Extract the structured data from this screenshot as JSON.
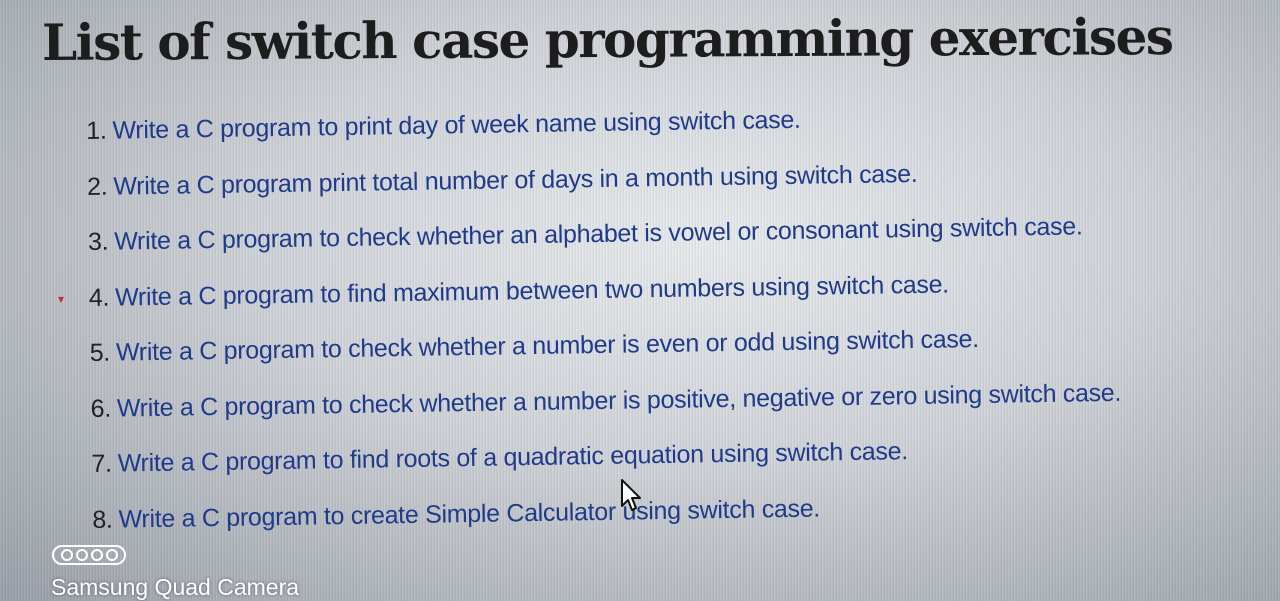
{
  "page": {
    "title": "List of switch case programming exercises"
  },
  "exercises": [
    {
      "number": "1.",
      "text": "Write a C program to print day of week name using switch case."
    },
    {
      "number": "2.",
      "text": "Write a C program print total number of days in a month using switch case."
    },
    {
      "number": "3.",
      "text": "Write a C program to check whether an alphabet is vowel or consonant using switch case."
    },
    {
      "number": "4.",
      "text": "Write a C program to find maximum between two numbers using switch case."
    },
    {
      "number": "5.",
      "text": "Write a C program to check whether a number is even or odd using switch case."
    },
    {
      "number": "6.",
      "text": "Write a C program to check whether a number is positive, negative or zero using switch case."
    },
    {
      "number": "7.",
      "text": "Write a C program to find roots of a quadratic equation using switch case."
    },
    {
      "number": "8.",
      "text": "Write a C program to create Simple Calculator using switch case."
    }
  ],
  "camera": {
    "watermark": "Samsung Quad Camera",
    "badge_icon": "quad-camera-icon"
  },
  "colors": {
    "title": "#1d1d1d",
    "link_text": "#1f3a8a",
    "watermark": "#ffffff"
  },
  "cursor_icon": "mouse-pointer-icon"
}
